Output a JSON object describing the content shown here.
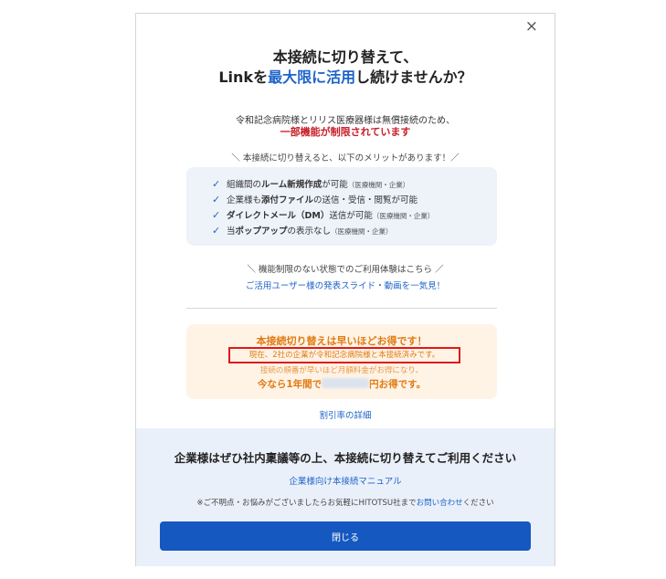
{
  "dialog": {
    "close_glyph": "×",
    "title_line1": "本接続に切り替えて、",
    "title_line2_pre": "Linkを",
    "title_line2_accent": "最大限に活用",
    "title_line2_post": "し続けませんか？",
    "notice_line1": "令和記念病院様とリリス医療器様は無償接続のため、",
    "notice_line2": "一部機能が制限されています",
    "merits_heading": "＼ 本接続に切り替えると、以下のメリットがあります！／",
    "benefits": [
      {
        "pre": "組織間の",
        "bold": "ルーム新規作成",
        "post": "が可能",
        "note": "（医療機関・企業）"
      },
      {
        "pre": "企業様も",
        "bold": "添付ファイル",
        "post": "の送信・受信・閲覧が可能",
        "note": ""
      },
      {
        "pre": "",
        "bold": "ダイレクトメール（DM）",
        "post": "送信が可能",
        "note": "（医療機関・企業）"
      },
      {
        "pre": "当",
        "bold": "ポップアップ",
        "post": "の表示なし",
        "note": "（医療機関・企業）"
      }
    ],
    "trial_heading": "＼ 機能制限のない状態でのご利用体験はこちら ／",
    "trial_link": "ご活用ユーザー様の発表スライド・動画を一気見！",
    "promo": {
      "line1": "本接続切り替えは早いほどお得です！",
      "line2": "現在、2社の企業が令和記念病院様と本接続済みです。",
      "line3": "接続の順番が早いほど月額料金がお得になり、",
      "line4_pre": "今なら1年間で",
      "line4_post": "円お得です。"
    },
    "discount_link": "割引率の詳細",
    "footer": {
      "heading": "企業様はぜひ社内稟議等の上、本接続に切り替えてご利用ください",
      "manual_link": "企業様向け本接続マニュアル",
      "note_pre": "※ご不明点・お悩みがございましたらお気軽にHITOTSU社まで",
      "note_link": "お問い合わせ",
      "note_post": "ください",
      "close_button": "閉じる"
    }
  }
}
